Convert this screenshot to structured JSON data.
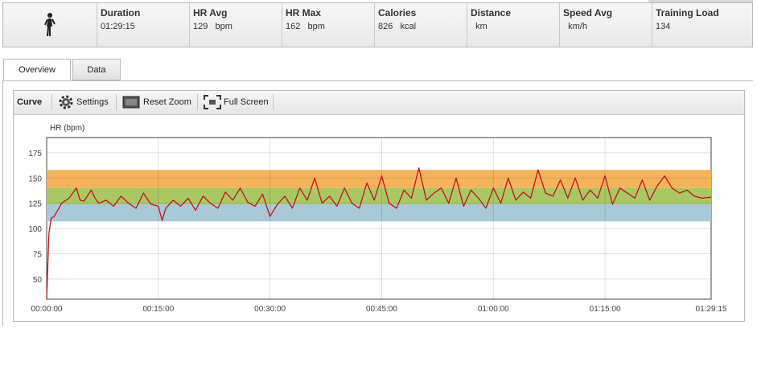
{
  "summary": {
    "stats": [
      {
        "label": "Duration",
        "value": "01:29:15"
      },
      {
        "label": "HR Avg",
        "value": "129   bpm"
      },
      {
        "label": "HR Max",
        "value": "162   bpm"
      },
      {
        "label": "Calories",
        "value": "826   kcal"
      },
      {
        "label": "Distance",
        "value": "  km"
      },
      {
        "label": "Speed Avg",
        "value": "  km/h"
      },
      {
        "label": "Training Load",
        "value": "134"
      }
    ]
  },
  "tabs": [
    {
      "label": "Overview",
      "active": true
    },
    {
      "label": "Data",
      "active": false
    }
  ],
  "toolbar": {
    "curve_label": "Curve",
    "settings_label": "Settings",
    "reset_zoom_label": "Reset Zoom",
    "full_screen_label": "Full Screen"
  },
  "chart_data": {
    "type": "line",
    "ylabel": "HR (bpm)",
    "xlabel": "",
    "y_ticks": [
      "175",
      "150",
      "125",
      "100",
      "75",
      "50"
    ],
    "x_ticks": [
      "00:00:00",
      "00:15:00",
      "00:30:00",
      "00:45:00",
      "01:00:00",
      "01:15:00",
      "01:29:15"
    ],
    "xlim_minutes": [
      0,
      89.25
    ],
    "ylim": [
      30,
      190
    ],
    "grid": true,
    "zones": [
      {
        "from": 107,
        "to": 124,
        "color": "#a9c9d8"
      },
      {
        "from": 124,
        "to": 140,
        "color": "#a9c863"
      },
      {
        "from": 140,
        "to": 158,
        "color": "#f5b35c"
      }
    ],
    "line_color": "#c0141b",
    "series": [
      {
        "x": [
          0,
          0.3,
          0.6,
          1,
          1.5,
          2,
          3,
          4,
          4.5,
          5,
          6,
          6.5,
          7,
          8,
          9,
          10,
          11,
          12,
          13,
          14,
          15,
          15.5,
          16,
          17,
          18,
          19,
          20,
          21,
          22,
          23,
          24,
          25,
          26,
          27,
          28,
          29,
          30,
          31,
          32,
          33,
          34,
          35,
          36,
          37,
          38,
          39,
          40,
          41,
          42,
          43,
          44,
          45,
          46,
          47,
          48,
          49,
          50,
          51,
          52,
          53,
          54,
          55,
          56,
          57,
          58,
          59,
          60,
          61,
          62,
          63,
          64,
          65,
          66,
          67,
          68,
          69,
          70,
          71,
          72,
          73,
          74,
          75,
          76,
          77,
          78,
          79,
          80,
          81,
          82,
          83,
          84,
          85,
          86,
          87,
          88,
          89.25
        ],
        "values": [
          30,
          95,
          110,
          112,
          118,
          125,
          130,
          140,
          128,
          127,
          138,
          130,
          125,
          128,
          122,
          132,
          125,
          120,
          135,
          124,
          122,
          108,
          120,
          128,
          122,
          130,
          118,
          132,
          125,
          120,
          136,
          128,
          140,
          126,
          122,
          134,
          112,
          124,
          132,
          120,
          140,
          128,
          150,
          125,
          132,
          122,
          140,
          125,
          120,
          145,
          128,
          152,
          125,
          120,
          138,
          130,
          160,
          128,
          135,
          140,
          125,
          150,
          122,
          138,
          130,
          120,
          140,
          125,
          150,
          128,
          136,
          130,
          158,
          135,
          132,
          148,
          130,
          150,
          128,
          138,
          130,
          152,
          124,
          140,
          135,
          130,
          148,
          128,
          142,
          152,
          140,
          135,
          138,
          132,
          130,
          131
        ]
      }
    ]
  }
}
